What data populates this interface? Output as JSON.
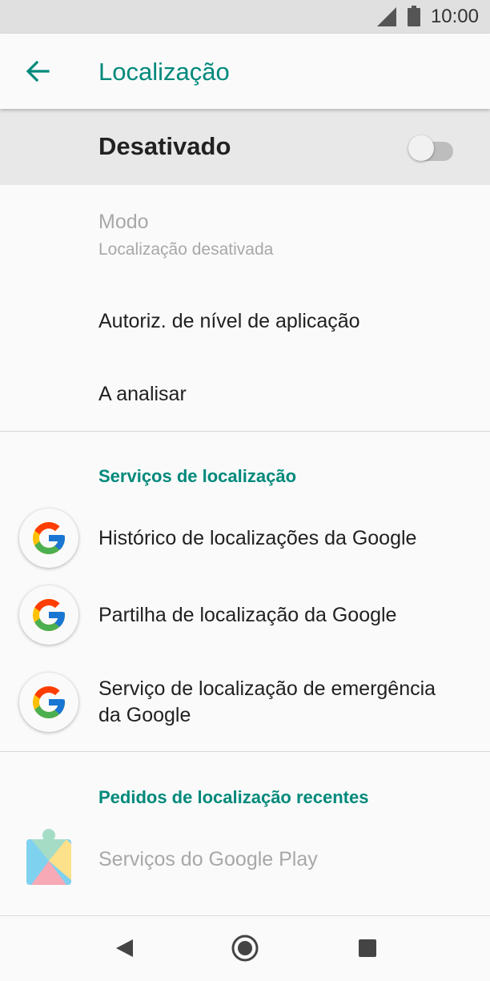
{
  "status_bar": {
    "time": "10:00",
    "icons": [
      "signal-icon",
      "battery-icon"
    ]
  },
  "app_bar": {
    "back_icon": "arrow-left-icon",
    "title": "Localização"
  },
  "master_switch": {
    "label": "Desativado",
    "state": "off"
  },
  "settings": [
    {
      "title": "Modo",
      "subtitle": "Localização desativada",
      "disabled": true
    },
    {
      "title": "Autoriz. de nível de aplicação"
    },
    {
      "title": "A analisar"
    }
  ],
  "location_services": {
    "header": "Serviços de localização",
    "items": [
      {
        "icon": "google-g-icon",
        "title": "Histórico de localizações da Google"
      },
      {
        "icon": "google-g-icon",
        "title": "Partilha de localização da Google"
      },
      {
        "icon": "google-g-icon",
        "title_line1": "Serviço de localização de emergência",
        "title_line2": "da Google"
      }
    ]
  },
  "recent_requests": {
    "header": "Pedidos de localização recentes",
    "items": [
      {
        "icon": "google-play-services-icon",
        "title": "Serviços do Google Play",
        "disabled": true
      }
    ]
  },
  "nav_bar": {
    "buttons": [
      "back-triangle-icon",
      "home-circle-icon",
      "recents-square-icon"
    ]
  },
  "colors": {
    "accent": "#00897b",
    "text": "#212121",
    "disabled_text": "#a8a8a8",
    "master_bg": "#e8e8e8",
    "status_bar_bg": "#e0e0e0"
  }
}
